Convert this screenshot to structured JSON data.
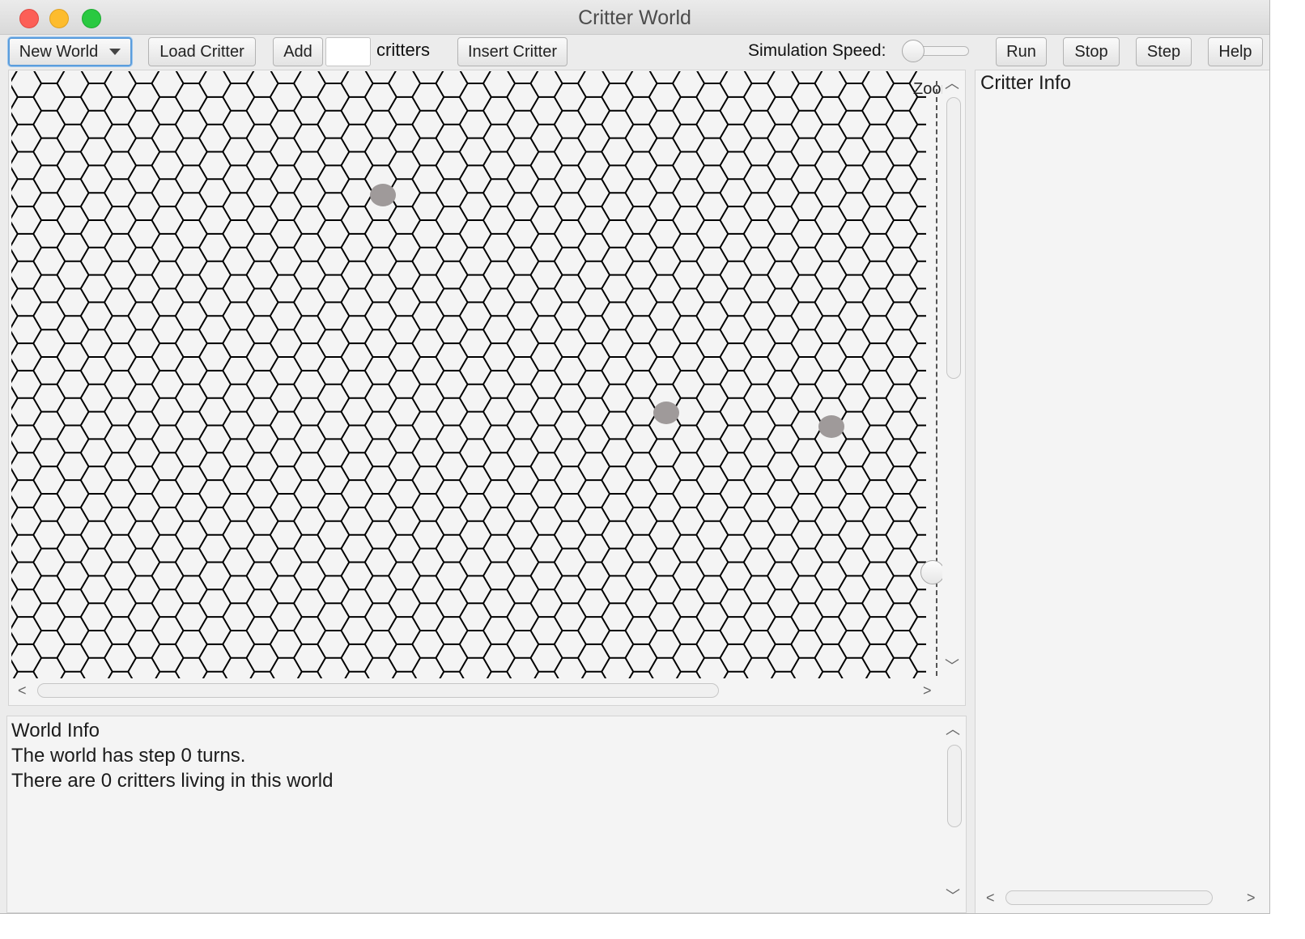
{
  "window": {
    "title": "Critter World"
  },
  "toolbar": {
    "new_world_label": "New World",
    "load_critter_label": "Load Critter",
    "add_label": "Add",
    "add_count_value": "",
    "critters_label": "critters",
    "insert_critter_label": "Insert Critter",
    "speed_label": "Simulation Speed:",
    "speed_value": 0,
    "run_label": "Run",
    "stop_label": "Stop",
    "step_label": "Step",
    "help_label": "Help"
  },
  "world_view": {
    "zoom_label": "Zoom",
    "zoom_value": 0.82,
    "hex_color": "#000000",
    "critter_color": "#9f9a9a"
  },
  "world_info": {
    "title": "World Info",
    "lines": [
      "The world has step 0 turns.",
      "There are 0 critters living in this world"
    ]
  },
  "critter_info": {
    "title": "Critter Info"
  }
}
